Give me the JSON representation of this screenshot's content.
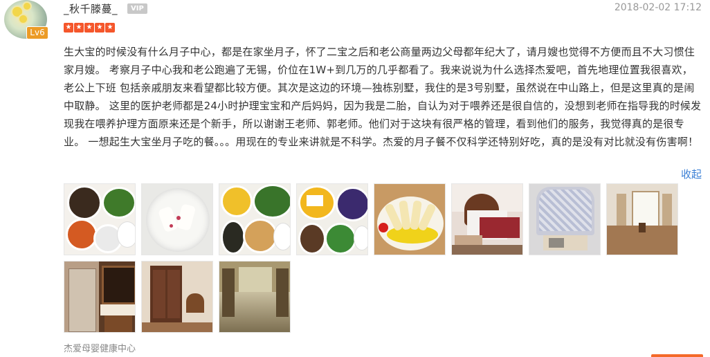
{
  "user": {
    "name": "_秋千滕蔓_",
    "vip_label": "VIP",
    "level": "Lv6"
  },
  "review": {
    "date": "2018-02-02 17:12",
    "rating": 5,
    "text": "生大宝的时候没有什么月子中心，都是在家坐月子，怀了二宝之后和老公商量两边父母都年纪大了，请月嫂也觉得不方便而且不大习惯住家月嫂。 考察月子中心我和老公跑遍了无锡，价位在1W+到几万的几乎都看了。我来说说为什么选择杰爱吧，首先地理位置我很喜欢，老公上下班 包括亲戚朋友来看望都比较方便。其次是这边的环境—独栋别墅，我住的是3号别墅，虽然说在中山路上，但是这里真的是闹中取静。 这里的医护老师都是24小时护理宝宝和产后妈妈，因为我是二胎，自认为对于喂养还是很自信的，没想到老师在指导我的时候发现我在喂养护理方面原来还是个新手，所以谢谢王老师、郭老师。他们对于这块有很严格的管理，看到他们的服务，我觉得真的是很专业。 一想起生大宝坐月子吃的餐。。。用现在的专业来讲就是不科学。杰爱的月子餐不仅科学还特别好吃，真的是没有对比就没有伤害啊！",
    "collapse_label": "收起",
    "shop_name": "杰爱母婴健康中心"
  },
  "photos": [
    {
      "name": "photo-meal-dishes-1"
    },
    {
      "name": "photo-soup-bowl"
    },
    {
      "name": "photo-meal-dishes-2"
    },
    {
      "name": "photo-meal-dishes-3"
    },
    {
      "name": "photo-plated-dish"
    },
    {
      "name": "photo-bedroom"
    },
    {
      "name": "photo-crib"
    },
    {
      "name": "photo-hallway-window"
    },
    {
      "name": "photo-bathroom"
    },
    {
      "name": "photo-wardrobe"
    },
    {
      "name": "photo-villa-corridor"
    }
  ],
  "colors": {
    "star": "#f5562b",
    "link": "#3a7fd5",
    "level_badge": "#ec9b26"
  }
}
